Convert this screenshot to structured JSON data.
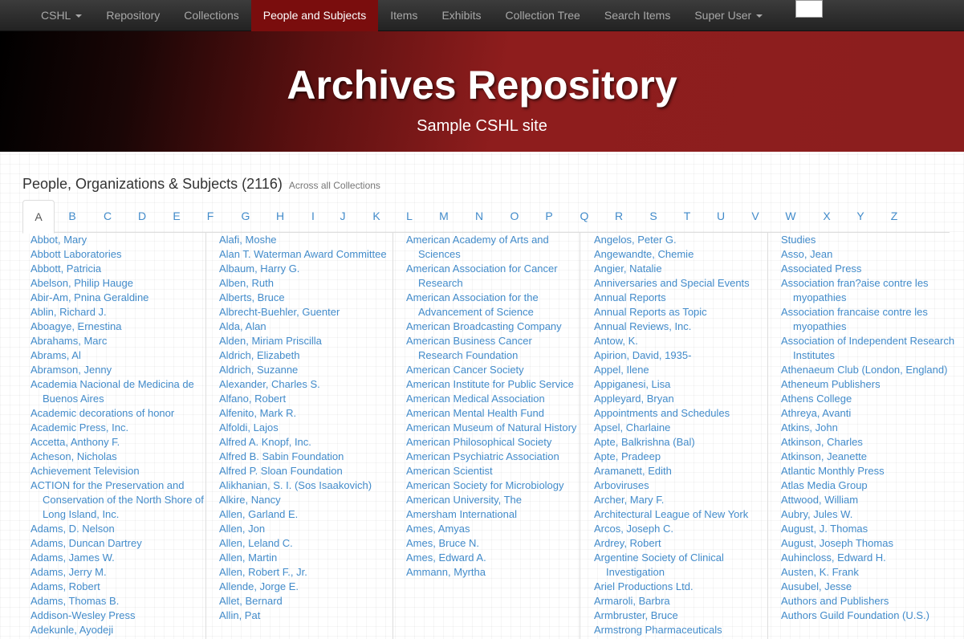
{
  "nav": {
    "items": [
      {
        "label": "CSHL",
        "dropdown": true
      },
      {
        "label": "Repository"
      },
      {
        "label": "Collections"
      },
      {
        "label": "People and Subjects",
        "active": true
      },
      {
        "label": "Items"
      },
      {
        "label": "Exhibits"
      },
      {
        "label": "Collection Tree"
      },
      {
        "label": "Search Items"
      },
      {
        "label": "Super User",
        "dropdown": true
      }
    ]
  },
  "banner": {
    "title": "Archives Repository",
    "subtitle": "Sample CSHL site"
  },
  "heading": {
    "title": "People, Organizations & Subjects (2116)",
    "sub": "Across all Collections"
  },
  "letters": [
    "A",
    "B",
    "C",
    "D",
    "E",
    "F",
    "G",
    "H",
    "I",
    "J",
    "K",
    "L",
    "M",
    "N",
    "O",
    "P",
    "Q",
    "R",
    "S",
    "T",
    "U",
    "V",
    "W",
    "X",
    "Y",
    "Z"
  ],
  "active_letter": "A",
  "columns": [
    [
      "Abbot, Mary",
      "Abbott Laboratories",
      "Abbott, Patricia",
      "Abelson, Philip Hauge",
      "Abir-Am, Pnina Geraldine",
      "Ablin, Richard J.",
      "Aboagye, Ernestina",
      "Abrahams, Marc",
      "Abrams, Al",
      "Abramson, Jenny",
      "Academia Nacional de Medicina de Buenos Aires",
      "Academic decorations of honor",
      "Academic Press, Inc.",
      "Accetta, Anthony F.",
      "Acheson, Nicholas",
      "Achievement Television",
      "ACTION for the Preservation and Conservation of the North Shore of Long Island, Inc.",
      "Adams, D. Nelson",
      "Adams, Duncan Dartrey",
      "Adams, James W.",
      "Adams, Jerry M.",
      "Adams, Robert",
      "Adams, Thomas B.",
      "Addison-Wesley Press",
      "Adekunle, Ayodeji"
    ],
    [
      "Alafi, Moshe",
      "Alan T. Waterman Award Committee",
      "Albaum, Harry G.",
      "Alben, Ruth",
      "Alberts, Bruce",
      "Albrecht-Buehler, Guenter",
      "Alda, Alan",
      "Alden, Miriam Priscilla",
      "Aldrich, Elizabeth",
      "Aldrich, Suzanne",
      "Alexander, Charles S.",
      "Alfano, Robert",
      "Alfenito, Mark R.",
      "Alfoldi, Lajos",
      "Alfred A. Knopf, Inc.",
      "Alfred B. Sabin Foundation",
      "Alfred P. Sloan Foundation",
      "Alikhanian, S. I. (Sos Isaakovich)",
      "Alkire, Nancy",
      "Allen, Garland E.",
      "Allen, Jon",
      "Allen, Leland C.",
      "Allen, Martin",
      "Allen, Robert F., Jr.",
      "Allende, Jorge E.",
      "Allet, Bernard",
      "Allin, Pat"
    ],
    [
      "American Academy of Arts and Sciences",
      "American Association for Cancer Research",
      "American Association for the Advancement of Science",
      "American Broadcasting Company",
      "American Business Cancer Research Foundation",
      "American Cancer Society",
      "American Institute for Public Service",
      "American Medical Association",
      "American Mental Health Fund",
      "American Museum of Natural History",
      "American Philosophical Society",
      "American Psychiatric Association",
      "American Scientist",
      "American Society for Microbiology",
      "American University, The",
      "Amersham International",
      "Ames, Amyas",
      "Ames, Bruce N.",
      "Ames, Edward A.",
      "Ammann, Myrtha"
    ],
    [
      "Angelos, Peter G.",
      "Angewandte, Chemie",
      "Angier, Natalie",
      "Anniversaries and Special Events",
      "Annual Reports",
      "Annual Reports as Topic",
      "Annual Reviews, Inc.",
      "Antow, K.",
      "Apirion, David, 1935-",
      "Appel, Ilene",
      "Appiganesi, Lisa",
      "Appleyard, Bryan",
      "Appointments and Schedules",
      "Apsel, Charlaine",
      "Apte, Balkrishna (Bal)",
      "Apte, Pradeep",
      "Aramanett, Edith",
      "Arboviruses",
      "Archer, Mary F.",
      "Architectural League of New York",
      "Arcos, Joseph C.",
      "Ardrey, Robert",
      "Argentine Society of Clinical Investigation",
      "Ariel Productions Ltd.",
      "Armaroli, Barbra",
      "Armbruster, Bruce",
      "Armstrong Pharmaceuticals"
    ],
    [
      "Studies",
      "Asso, Jean",
      "Associated Press",
      "Association fran?aise contre les myopathies",
      "Association francaise contre les myopathies",
      "Association of Independent Research Institutes",
      "Athenaeum Club (London, England)",
      "Atheneum Publishers",
      "Athens College",
      "Athreya, Avanti",
      "Atkins, John",
      "Atkinson, Charles",
      "Atkinson, Jeanette",
      "Atlantic Monthly Press",
      "Atlas Media Group",
      "Attwood, William",
      "Aubry, Jules W.",
      "August, J. Thomas",
      "August, Joseph Thomas",
      "Auhincloss, Edward H.",
      "Austen, K. Frank",
      "Ausubel, Jesse",
      "Authors and Publishers",
      "Authors Guild Foundation (U.S.)"
    ]
  ]
}
